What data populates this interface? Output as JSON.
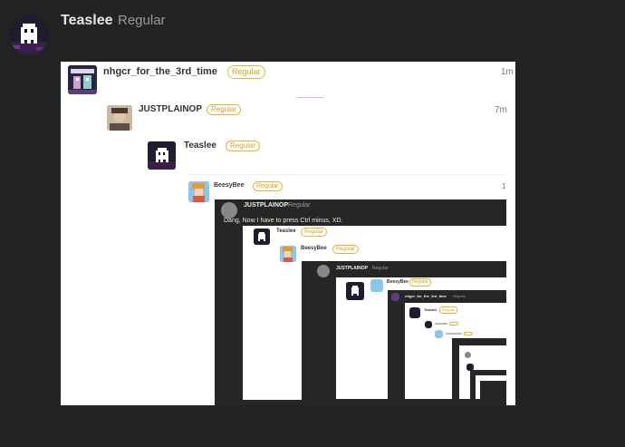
{
  "post": {
    "username": "Teaslee",
    "role": "Regular"
  },
  "screenshot": {
    "level1": {
      "username": "nhgcr_for_the_3rd_time",
      "role": "Regular",
      "time": "1m"
    },
    "level2": {
      "username": "JUSTPLAINOP",
      "role": "Regular",
      "time": "7m"
    },
    "level3": {
      "username": "Teaslee",
      "role": "Regular"
    },
    "level4": {
      "username": "BeesyBee",
      "role": "Regular",
      "time": "1"
    },
    "quote": {
      "username": "JUSTPLAINOP",
      "role": "Regular",
      "text": "Dang, Now I have to press Ctrl minus, XD.",
      "nested1": {
        "username": "Teaslee",
        "role": "Regular"
      },
      "nested2": {
        "username": "BeesyBee",
        "role": "Regular"
      },
      "nested3": {
        "username": "JUSTPLAINOP",
        "role": "Regular"
      },
      "nested4": {
        "username": "BeesyBee",
        "role": "Regular"
      },
      "nested5": {
        "username": "nhgcr_for_the_3rd_time",
        "role": "Regular"
      },
      "nested6": {
        "username": "Teaslee",
        "role": "Regular"
      }
    }
  },
  "colors": {
    "background": "#232323",
    "badge": "#d6a21e",
    "dark_panel": "#262626"
  }
}
